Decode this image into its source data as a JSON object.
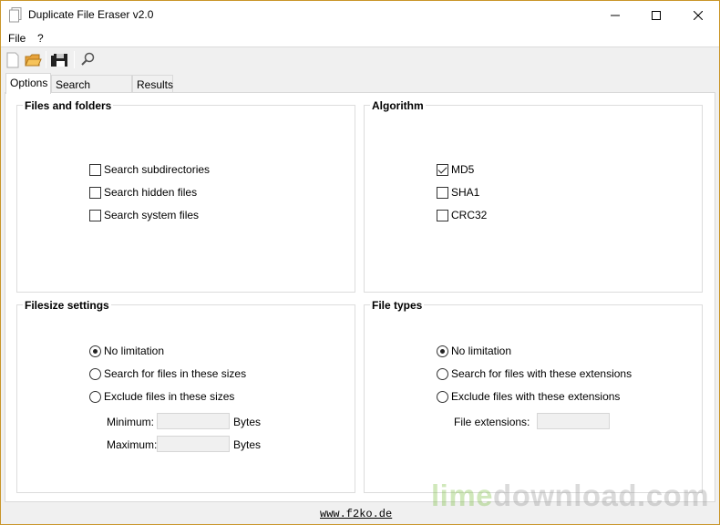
{
  "window": {
    "title": "Duplicate File Eraser v2.0"
  },
  "menu": {
    "file": "File",
    "help": "?"
  },
  "tabs": [
    {
      "label": "Options"
    },
    {
      "label": "Search locations"
    },
    {
      "label": "Results"
    }
  ],
  "files_and_folders": {
    "title": "Files and folders",
    "items": [
      {
        "label": "Search subdirectories",
        "checked": false
      },
      {
        "label": "Search hidden files",
        "checked": false
      },
      {
        "label": "Search system files",
        "checked": false
      }
    ]
  },
  "algorithm": {
    "title": "Algorithm",
    "items": [
      {
        "label": "MD5",
        "checked": true
      },
      {
        "label": "SHA1",
        "checked": false
      },
      {
        "label": "CRC32",
        "checked": false
      }
    ]
  },
  "filesize": {
    "title": "Filesize settings",
    "options": [
      {
        "label": "No limitation",
        "selected": true
      },
      {
        "label": "Search for files in these sizes",
        "selected": false
      },
      {
        "label": "Exclude files in these sizes",
        "selected": false
      }
    ],
    "minimum_label": "Minimum:",
    "maximum_label": "Maximum:",
    "minimum_value": "",
    "maximum_value": "",
    "unit": "Bytes"
  },
  "file_types": {
    "title": "File types",
    "options": [
      {
        "label": "No limitation",
        "selected": true
      },
      {
        "label": "Search for files with these extensions",
        "selected": false
      },
      {
        "label": "Exclude files with these extensions",
        "selected": false
      }
    ],
    "extensions_label": "File extensions:",
    "extensions_value": ""
  },
  "footer": {
    "link": "www.f2ko.de"
  },
  "watermark": {
    "lime": "lime",
    "rest": "download.com"
  }
}
